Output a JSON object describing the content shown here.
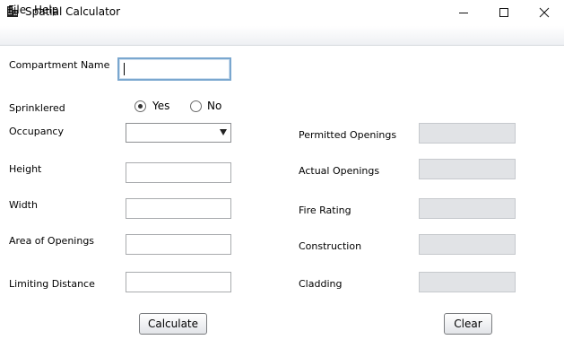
{
  "window": {
    "title": "Spatial Calculator"
  },
  "menu": {
    "file": "File",
    "help": "Help"
  },
  "form": {
    "compartment_name_label": "Compartment Name",
    "compartment_name_value": "",
    "sprinklered_label": "Sprinklered",
    "sprinklered_yes": "Yes",
    "sprinklered_no": "No",
    "sprinklered_selected": "Yes",
    "occupancy_label": "Occupancy",
    "occupancy_value": "",
    "height_label": "Height",
    "width_label": "Width",
    "area_of_openings_label": "Area of Openings",
    "limiting_distance_label": "Limiting Distance"
  },
  "results": {
    "permitted_openings_label": "Permitted Openings",
    "actual_openings_label": "Actual Openings",
    "fire_rating_label": "Fire Rating",
    "construction_label": "Construction",
    "cladding_label": "Cladding"
  },
  "buttons": {
    "calculate": "Calculate",
    "clear": "Clear"
  }
}
